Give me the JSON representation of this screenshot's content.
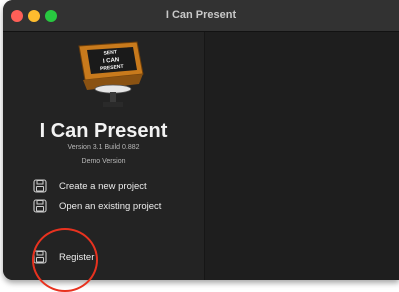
{
  "window": {
    "title": "I Can Present",
    "traffic_colors": {
      "close": "#ff5f57",
      "minimize": "#febc2e",
      "maximize": "#28c840"
    }
  },
  "sidebar": {
    "logo": {
      "icon": "teleprompter-logo-icon",
      "screen_text": [
        "SENT",
        "I CAN",
        "PRESENT"
      ]
    },
    "app_name": "I Can Present",
    "version": "Version 3.1 Build 0.882",
    "edition": "Demo Version",
    "actions": [
      {
        "label": "Create a new project",
        "icon": "floppy-disk-icon"
      },
      {
        "label": "Open an existing project",
        "icon": "floppy-disk-icon"
      },
      {
        "label": "Register",
        "icon": "floppy-disk-icon"
      }
    ]
  },
  "annotation": {
    "color": "#e8321f"
  }
}
